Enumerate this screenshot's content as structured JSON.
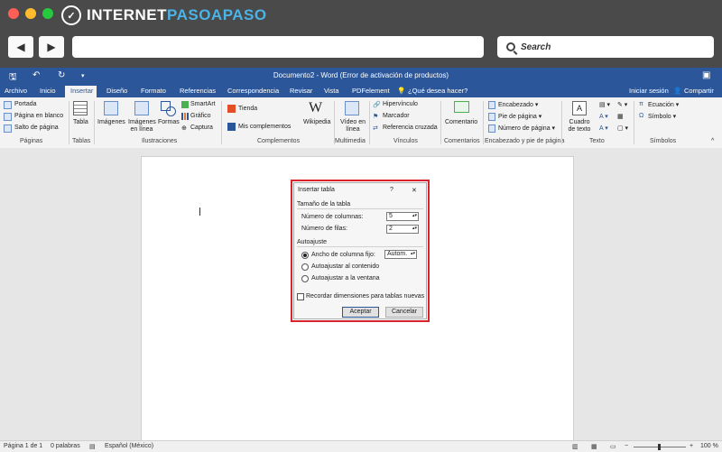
{
  "browser": {
    "logo_text_a": "INTERNET",
    "logo_text_b": "PASOAPASO",
    "back_icon": "◀",
    "forward_icon": "▶",
    "search_label": "Search"
  },
  "word": {
    "title": "Documento2 - Word (Error de activación de productos)",
    "tabs": [
      "Archivo",
      "Inicio",
      "Insertar",
      "Diseño",
      "Formato",
      "Referencias",
      "Correspondencia",
      "Revisar",
      "Vista",
      "PDFelement"
    ],
    "tell_me": "¿Qué desea hacer?",
    "sign_in": "Iniciar sesión",
    "share": "Compartir",
    "ribbon": {
      "paginas": {
        "items": [
          "Portada",
          "Página en blanco",
          "Salto de página"
        ],
        "label": "Páginas"
      },
      "tablas": {
        "item": "Tabla",
        "label": "Tablas"
      },
      "ilustraciones": {
        "items": [
          "Imágenes",
          "Imágenes en línea",
          "Formas",
          "SmartArt",
          "Gráfico",
          "Captura"
        ],
        "label": "Ilustraciones"
      },
      "complementos": {
        "items": [
          "Tienda",
          "Mis complementos",
          "Wikipedia"
        ],
        "label": "Complementos"
      },
      "multimedia": {
        "item": "Vídeo en línea",
        "label": "Multimedia"
      },
      "vinculos": {
        "items": [
          "Hipervínculo",
          "Marcador",
          "Referencia cruzada"
        ],
        "label": "Vínculos"
      },
      "comentarios": {
        "item": "Comentario",
        "label": "Comentarios"
      },
      "encabezado": {
        "items": [
          "Encabezado",
          "Pie de página",
          "Número de página"
        ],
        "label": "Encabezado y pie de página"
      },
      "texto": {
        "item": "Cuadro de texto",
        "label": "Texto"
      },
      "simbolos": {
        "items": [
          "Ecuación",
          "Símbolo"
        ],
        "label": "Símbolos"
      }
    },
    "status": {
      "page": "Página 1 de 1",
      "words": "0 palabras",
      "lang": "Español (México)",
      "zoom": "100 %"
    }
  },
  "dialog": {
    "title": "Insertar tabla",
    "help": "?",
    "close": "✕",
    "section_size": "Tamaño de la tabla",
    "columns_label": "Número de columnas:",
    "columns_value": "5",
    "rows_label": "Número de filas:",
    "rows_value": "2",
    "section_autofit": "Autoajuste",
    "radio_fixed": "Ancho de columna fijo:",
    "fixed_value": "Autom.",
    "radio_content": "Autoajustar al contenido",
    "radio_window": "Autoajustar a la ventana",
    "remember": "Recordar dimensiones para tablas nuevas",
    "ok": "Aceptar",
    "cancel": "Cancelar"
  },
  "colors": {
    "word_blue": "#2b579a",
    "highlight_red": "#d9232d",
    "logo_blue": "#4ab3e8"
  }
}
